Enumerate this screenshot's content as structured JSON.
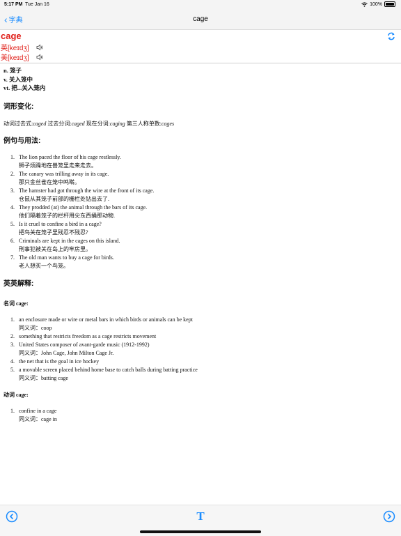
{
  "status": {
    "time": "5:17 PM",
    "day": "Tue Jan 16",
    "battery": "100%"
  },
  "nav": {
    "back_label": "字典",
    "title": "cage"
  },
  "entry": {
    "word": "cage",
    "uk_pron": "英[keɪdʒ]",
    "us_pron": "美[keɪdʒ]",
    "definitions": [
      "n. 笼子",
      "v. 关入笼中",
      "vt. 把...关入笼内"
    ]
  },
  "sections": {
    "word_forms_title": "词形变化:",
    "examples_title": "例句与用法:",
    "english_title": "英英解释:"
  },
  "word_forms": {
    "past_label": "动词过去式:",
    "past": "caged",
    "pp_label": " 过去分词:",
    "pp": "caged",
    "prog_label": " 现在分词:",
    "prog": "caging",
    "third_label": " 第三人称单数:",
    "third": "cages"
  },
  "examples": [
    {
      "num": "1.",
      "en": "The lion paced the floor of his cage restlessly.",
      "zh": "狮子烦躁地在兽笼里走来走去。"
    },
    {
      "num": "2.",
      "en": "The canary was trilling away in its cage.",
      "zh": "那只金丝雀在笼中鸣啭。"
    },
    {
      "num": "3.",
      "en": "The hamster had got through the wire at the front of its cage.",
      "zh": "仓鼠从其笼子前部的栅栏处钻出去了."
    },
    {
      "num": "4.",
      "en": "They prodded (at) the animal through the bars of its cage.",
      "zh": "他们隔着笼子的栏杆用尖东西捅那动物."
    },
    {
      "num": "5.",
      "en": "Is it cruel to confine a bird in a cage?",
      "zh": "把鸟关在笼子里残忍不残忍?"
    },
    {
      "num": "6.",
      "en": "Criminals are kept in the cages on this island.",
      "zh": "刑事犯被关在岛上的牢房里。"
    },
    {
      "num": "7.",
      "en": "The old man wants to buy a cage for birds.",
      "zh": "老人想买一个鸟笼。"
    }
  ],
  "noun": {
    "label": "名词 cage:",
    "senses": [
      {
        "num": "1.",
        "text": "an enclosure made or wire or metal bars in which birds or animals can be kept",
        "syn": "同义词：coop"
      },
      {
        "num": "2.",
        "text": "something that restricts freedom as a cage restricts movement",
        "syn": ""
      },
      {
        "num": "3.",
        "text": "United States composer of avant-garde music (1912-1992)",
        "syn": "同义词：John Cage, John Milton Cage Jr."
      },
      {
        "num": "4.",
        "text": "the net that is the goal in ice hockey",
        "syn": ""
      },
      {
        "num": "5.",
        "text": "a movable screen placed behind home base to catch balls during batting practice",
        "syn": "同义词：batting cage"
      }
    ]
  },
  "verb": {
    "label": "动词 cage:",
    "senses": [
      {
        "num": "1.",
        "text": "confine in a cage",
        "syn": "同义词：cage in"
      }
    ]
  },
  "toolbar": {
    "font_glyph": "T"
  },
  "colors": {
    "accent": "#1a8cff",
    "word": "#e0201a"
  },
  "icons": {
    "back": "chevron-left-icon",
    "speaker": "speaker-icon",
    "refresh": "refresh-icon",
    "prev": "prev-circle-icon",
    "next": "next-circle-icon",
    "font": "font-size-icon"
  }
}
